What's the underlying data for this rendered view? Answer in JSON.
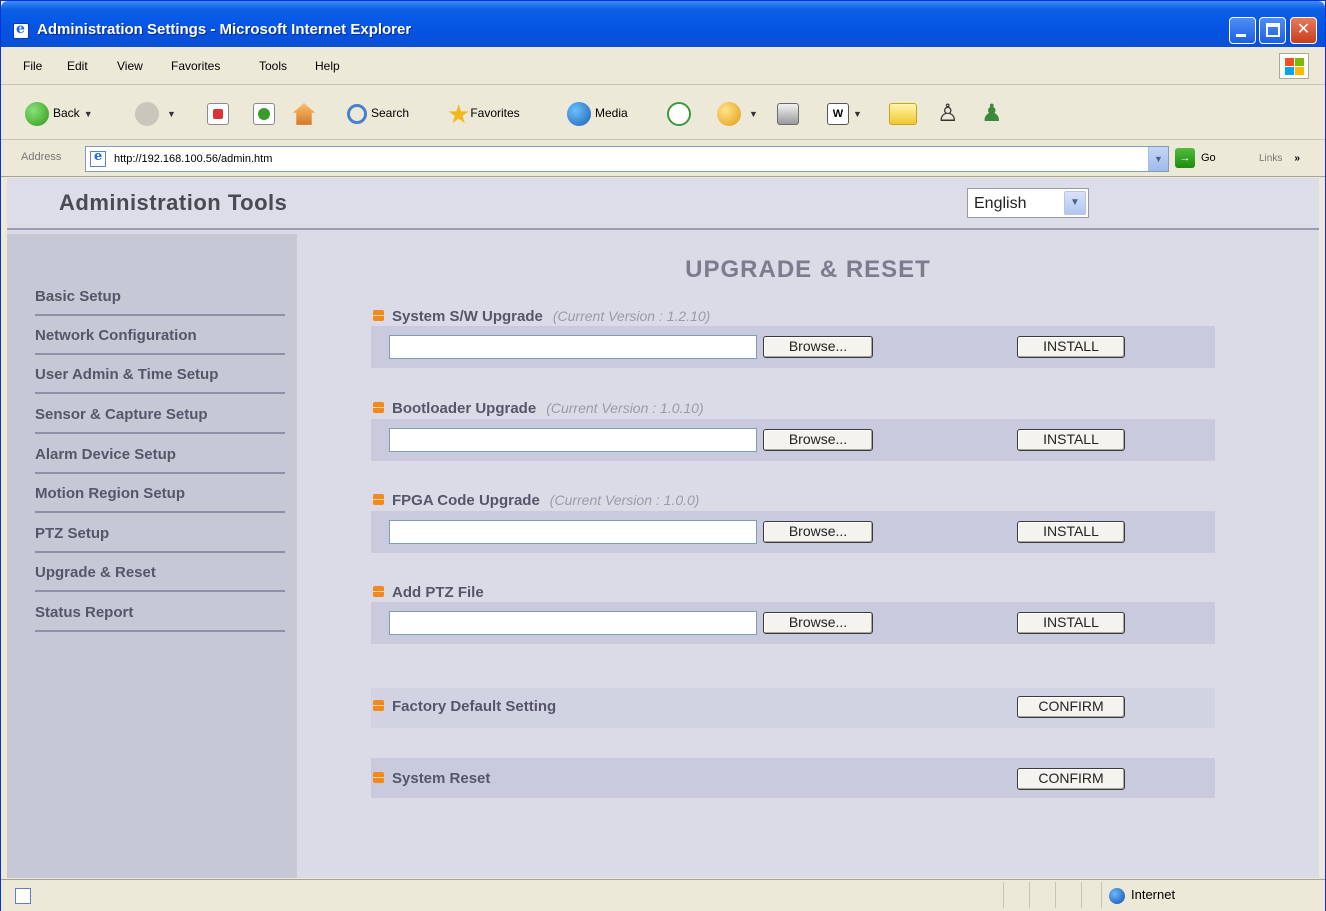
{
  "window": {
    "title": "Administration Settings - Microsoft Internet Explorer"
  },
  "menubar": {
    "items": [
      "File",
      "Edit",
      "View",
      "Favorites",
      "Tools",
      "Help"
    ]
  },
  "toolbar": {
    "back_label": "Back",
    "search_label": "Search",
    "favorites_label": "Favorites",
    "media_label": "Media"
  },
  "addressbar": {
    "label": "Address",
    "url": "http://192.168.100.56/admin.htm",
    "go_label": "Go",
    "links_label": "Links"
  },
  "header": {
    "title": "Administration Tools",
    "language": "English"
  },
  "sidebar": {
    "items": [
      "Basic Setup",
      "Network Configuration",
      "User Admin & Time Setup",
      "Sensor & Capture Setup",
      "Alarm Device Setup",
      "Motion Region Setup",
      "PTZ Setup",
      "Upgrade & Reset",
      "Status Report"
    ]
  },
  "main": {
    "title": "UPGRADE & RESET",
    "upgrades": [
      {
        "label": "System S/W Upgrade",
        "version": "(Current Version : 1.2.10)",
        "browse": "Browse...",
        "install": "INSTALL"
      },
      {
        "label": "Bootloader Upgrade",
        "version": "(Current Version : 1.0.10)",
        "browse": "Browse...",
        "install": "INSTALL"
      },
      {
        "label": "FPGA Code Upgrade",
        "version": "(Current Version : 1.0.0)",
        "browse": "Browse...",
        "install": "INSTALL"
      },
      {
        "label": "Add PTZ File",
        "version": "",
        "browse": "Browse...",
        "install": "INSTALL"
      }
    ],
    "factory_default": {
      "label": "Factory Default Setting",
      "button": "CONFIRM"
    },
    "system_reset": {
      "label": "System Reset",
      "button": "CONFIRM"
    }
  },
  "statusbar": {
    "zone": "Internet"
  },
  "colors": {
    "titlebar": "#0554e3",
    "bullet": "#f08a1c",
    "page_bg": "#dadbe6",
    "sidebar_bg": "#c7c8d6",
    "row_bg": "#c9cade"
  }
}
